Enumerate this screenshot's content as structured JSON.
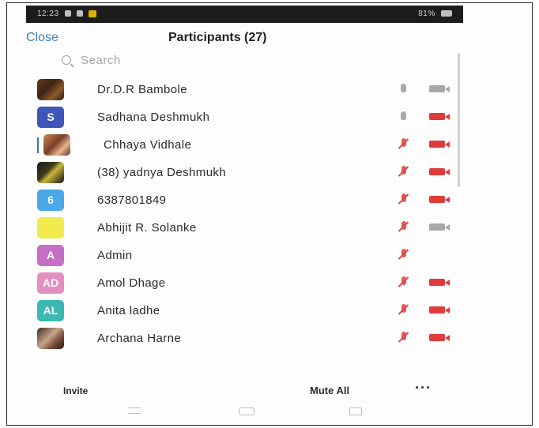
{
  "statusbar": {
    "left_text": "12:23",
    "right_text": "81%"
  },
  "header": {
    "close_label": "Close",
    "title": "Participants (27)"
  },
  "search": {
    "placeholder": "Search"
  },
  "participants": [
    {
      "name": "Dr.D.R Bambole",
      "avatar_type": "photo",
      "avatar_text": "",
      "avatar_color": "#6b3b1e",
      "mic": "on",
      "camera": "on"
    },
    {
      "name": "Sadhana Deshmukh",
      "avatar_type": "initials",
      "avatar_text": "S",
      "avatar_color": "#3f55b8",
      "mic": "on",
      "camera": "off"
    },
    {
      "name": "Chhaya Vidhale",
      "avatar_type": "photo",
      "avatar_text": "",
      "avatar_color": "#c98a4a",
      "mic": "muted",
      "camera": "off"
    },
    {
      "name": "(38) yadnya Deshmukh",
      "avatar_type": "photo",
      "avatar_text": "",
      "avatar_color": "#1b1b1b",
      "mic": "muted",
      "camera": "off"
    },
    {
      "name": "6387801849",
      "avatar_type": "initials",
      "avatar_text": "6",
      "avatar_color": "#4aa7e8",
      "mic": "muted",
      "camera": "off"
    },
    {
      "name": "Abhijit R. Solanke",
      "avatar_type": "initials",
      "avatar_text": "",
      "avatar_color": "#f2ea4a",
      "mic": "muted",
      "camera": "on"
    },
    {
      "name": "Admin",
      "avatar_type": "initials",
      "avatar_text": "A",
      "avatar_color": "#c46fc4",
      "mic": "muted",
      "camera": "none"
    },
    {
      "name": "Amol Dhage",
      "avatar_type": "initials",
      "avatar_text": "AD",
      "avatar_color": "#e58fc0",
      "mic": "muted",
      "camera": "off"
    },
    {
      "name": "Anita ladhe",
      "avatar_type": "initials",
      "avatar_text": "AL",
      "avatar_color": "#3bb8b0",
      "mic": "muted",
      "camera": "off"
    },
    {
      "name": "Archana Harne",
      "avatar_type": "photo",
      "avatar_text": "",
      "avatar_color": "#7a4a3a",
      "mic": "muted",
      "camera": "off"
    }
  ],
  "footer": {
    "invite_label": "Invite",
    "mute_all_label": "Mute All",
    "more_label": "···"
  },
  "icons": {
    "search": "search-icon",
    "mic": "microphone-icon",
    "mic_muted": "microphone-muted-icon",
    "camera": "video-camera-icon",
    "camera_off": "video-camera-off-icon",
    "nav_menu": "menu-icon",
    "nav_home": "home-icon",
    "nav_back": "back-icon"
  },
  "colors": {
    "accent": "#3d7fc4",
    "muted_red": "#e03b3b",
    "inactive_gray": "#a8a8a8"
  }
}
